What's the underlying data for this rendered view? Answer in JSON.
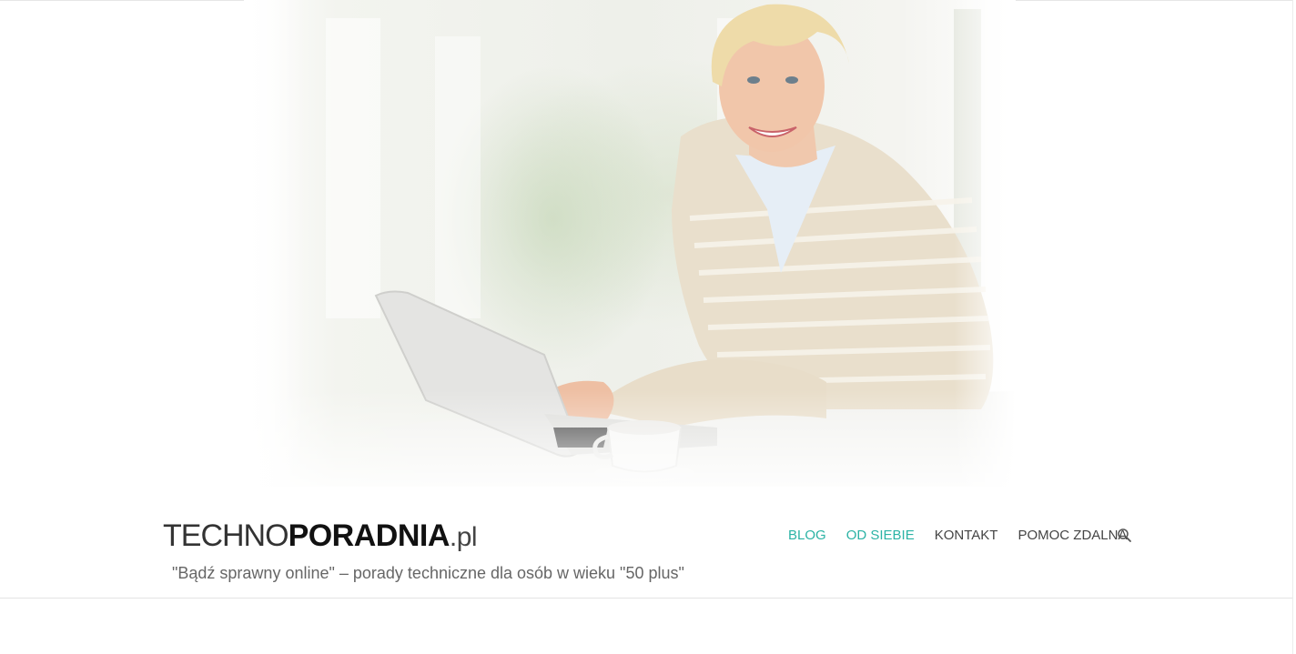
{
  "header": {
    "logo_part1": "TECHNO",
    "logo_part2": "PORADNIA",
    "logo_part3": ".pl",
    "tagline": "\"Bądź sprawny online\" – porady techniczne dla osób w wieku \"50 plus\""
  },
  "nav": {
    "items": [
      {
        "label": "BLOG",
        "state": "active"
      },
      {
        "label": "OD SIEBIE",
        "state": "active"
      },
      {
        "label": "KONTAKT",
        "state": "normal"
      },
      {
        "label": "POMOC ZDALNA",
        "state": "normal"
      }
    ],
    "search_icon": "search-icon"
  },
  "colors": {
    "accent": "#2bb3a5",
    "nav_text": "#444444",
    "tagline": "#666666"
  }
}
